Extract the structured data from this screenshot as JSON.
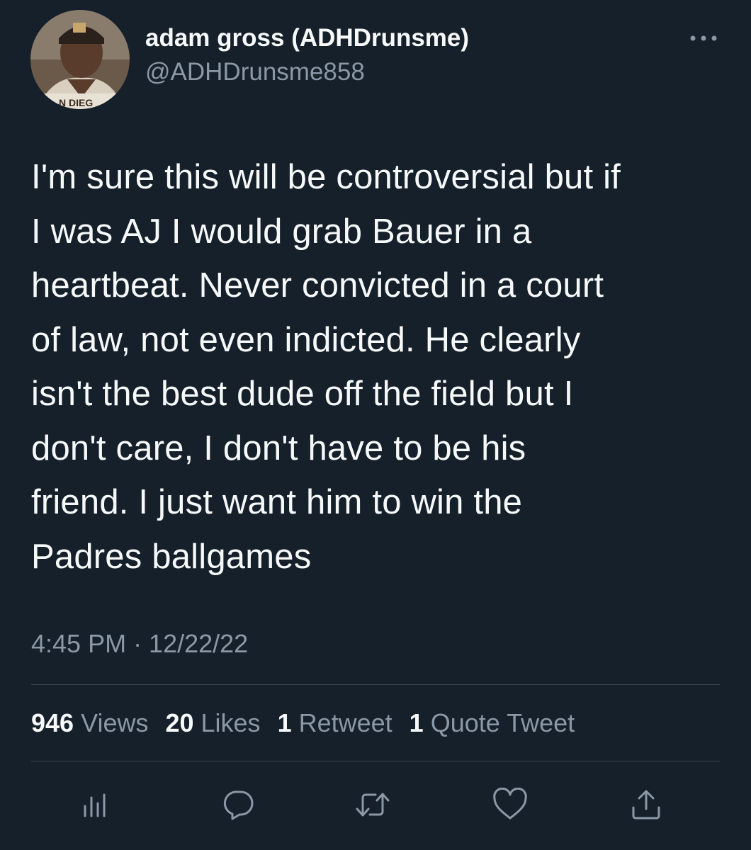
{
  "author": {
    "display_name": "adam gross (ADHDrunsme)",
    "handle": "@ADHDrunsme858",
    "avatar_icon": "profile-photo"
  },
  "tweet": {
    "text": "I'm sure this will be controversial but if\nI was AJ I would grab Bauer in a\nheartbeat.  Never convicted in a court\nof law, not even indicted.  He clearly\nisn't the best dude off the field but I\ndon't care, I don't have to be his\nfriend. I just want him to win the\nPadres ballgames",
    "time": "4:45 PM · 12/22/22"
  },
  "stats": {
    "views_count": "946",
    "views_label": "Views",
    "likes_count": "20",
    "likes_label": "Likes",
    "retweets_count": "1",
    "retweets_label": "Retweet",
    "quotes_count": "1",
    "quotes_label": "Quote Tweet"
  },
  "actions": [
    "analytics-icon",
    "reply-icon",
    "retweet-icon",
    "like-icon",
    "share-icon"
  ],
  "colors": {
    "background": "#15202b",
    "primary_text": "#f7f9f9",
    "secondary_text": "#8b98a5",
    "divider": "#38444d"
  }
}
